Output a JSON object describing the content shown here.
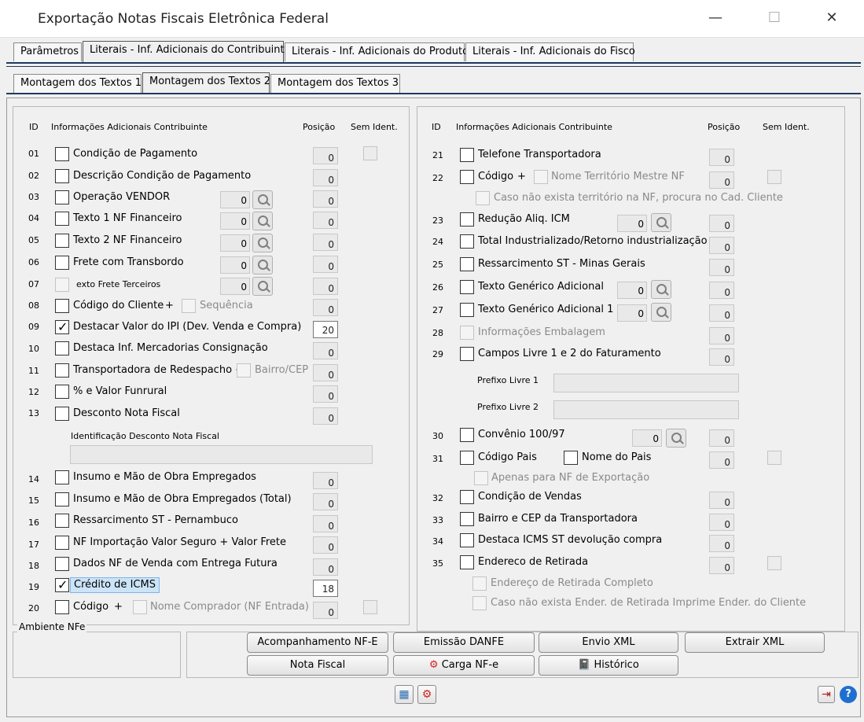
{
  "window": {
    "title": "Exportação Notas Fiscais Eletrônica Federal",
    "minimize": "—",
    "maximize": "☐",
    "close": "✕"
  },
  "tabs": [
    "Parâmetros",
    "Literais - Inf. Adicionais do Contribuinte",
    "Literais - Inf. Adicionais do Produto",
    "Literais - Inf. Adicionais do Fisco"
  ],
  "subtabs": [
    "Montagem dos Textos 1",
    "Montagem dos Textos 2",
    "Montagem dos Textos 3"
  ],
  "headers": {
    "id": "ID",
    "info": "Informações Adicionais Contribuinte",
    "posicao": "Posição",
    "sem": "Sem Ident."
  },
  "left": {
    "r01": {
      "id": "01",
      "label": "Condição de Pagamento",
      "pos": "0"
    },
    "r02": {
      "id": "02",
      "label": "Descrição Condição de Pagamento",
      "pos": "0"
    },
    "r03": {
      "id": "03",
      "label": "Operação VENDOR",
      "code": "0",
      "pos": "0"
    },
    "r04": {
      "id": "04",
      "label": "Texto 1 NF Financeiro",
      "code": "0",
      "pos": "0"
    },
    "r05": {
      "id": "05",
      "label": "Texto 2 NF Financeiro",
      "code": "0",
      "pos": "0"
    },
    "r06": {
      "id": "06",
      "label": "Frete com Transbordo",
      "code": "0",
      "pos": "0"
    },
    "r07": {
      "id": "07",
      "label": "exto Frete Terceiros",
      "code": "0",
      "pos": "0"
    },
    "r08": {
      "id": "08",
      "label": "Código do Cliente",
      "plus": "+",
      "extra": "Sequência",
      "pos": "0"
    },
    "r09": {
      "id": "09",
      "label": "Destacar Valor do IPI (Dev. Venda e Compra)",
      "pos": "20"
    },
    "r10": {
      "id": "10",
      "label": "Destaca Inf. Mercadorias Consignação",
      "pos": "0"
    },
    "r11": {
      "id": "11",
      "label": "Transportadora de Redespacho +",
      "extra": "Bairro/CEP",
      "pos": "0"
    },
    "r12": {
      "id": "12",
      "label": "% e Valor Funrural",
      "pos": "0"
    },
    "r13": {
      "id": "13",
      "label": "Desconto Nota Fiscal",
      "pos": "0"
    },
    "desc_label": "Identificação Desconto Nota Fiscal",
    "r14": {
      "id": "14",
      "label": "Insumo e Mão de Obra Empregados",
      "pos": "0"
    },
    "r15": {
      "id": "15",
      "label": "Insumo e Mão de Obra Empregados (Total)",
      "pos": "0"
    },
    "r16": {
      "id": "16",
      "label": "Ressarcimento ST - Pernambuco",
      "pos": "0"
    },
    "r17": {
      "id": "17",
      "label": "NF Importação Valor Seguro + Valor Frete",
      "pos": "0"
    },
    "r18": {
      "id": "18",
      "label": "Dados NF de Venda com Entrega Futura",
      "pos": "0"
    },
    "r19": {
      "id": "19",
      "label": "Crédito de ICMS",
      "pos": "18"
    },
    "r20": {
      "id": "20",
      "label": "Código",
      "plus": "+",
      "extra": "Nome Comprador (NF Entrada)",
      "pos": "0"
    }
  },
  "right": {
    "r21": {
      "id": "21",
      "label": "Telefone Transportadora",
      "pos": "0"
    },
    "r22": {
      "id": "22",
      "label": "Código",
      "plus": "+",
      "extra": "Nome Território Mestre NF",
      "pos": "0",
      "sub": "Caso não exista território na NF, procura no Cad. Cliente"
    },
    "r23": {
      "id": "23",
      "label": "Redução Aliq. ICM",
      "code": "0",
      "pos": "0"
    },
    "r24": {
      "id": "24",
      "label": "Total Industrializado/Retorno industrialização",
      "pos": "0"
    },
    "r25": {
      "id": "25",
      "label": "Ressarcimento ST - Minas Gerais",
      "pos": "0"
    },
    "r26": {
      "id": "26",
      "label": "Texto Genérico Adicional",
      "code": "0",
      "pos": "0"
    },
    "r27": {
      "id": "27",
      "label": "Texto Genérico Adicional 1",
      "code": "0",
      "pos": "0"
    },
    "r28": {
      "id": "28",
      "label": "Informações Embalagem",
      "pos": "0"
    },
    "r29": {
      "id": "29",
      "label": "Campos Livre 1 e 2 do Faturamento",
      "pos": "0"
    },
    "prefixo1": "Prefixo Livre 1",
    "prefixo2": "Prefixo Livre 2",
    "r30": {
      "id": "30",
      "label": "Convênio 100/97",
      "code": "0",
      "pos": "0"
    },
    "r31": {
      "id": "31",
      "label": "Código Pais",
      "extra": "Nome do Pais",
      "pos": "0",
      "sub": "Apenas para NF de Exportação"
    },
    "r32": {
      "id": "32",
      "label": "Condição de Vendas",
      "pos": "0"
    },
    "r33": {
      "id": "33",
      "label": "Bairro e CEP da Transportadora",
      "pos": "0"
    },
    "r34": {
      "id": "34",
      "label": "Destaca ICMS ST devolução compra",
      "pos": "0"
    },
    "r35": {
      "id": "35",
      "label": "Endereco de Retirada",
      "pos": "0",
      "sub1": "Endereço de Retirada Completo",
      "sub2": "Caso não exista Ender. de Retirada Imprime Ender. do Cliente"
    }
  },
  "ambiente": "Ambiente NFe",
  "buttons": {
    "acomp": "Acompanhamento NF-E",
    "danfe": "Emissão DANFE",
    "envio": "Envio XML",
    "extrair": "Extrair XML",
    "nota": "Nota Fiscal",
    "carga": "Carga NF-e",
    "historico": "Histórico"
  }
}
